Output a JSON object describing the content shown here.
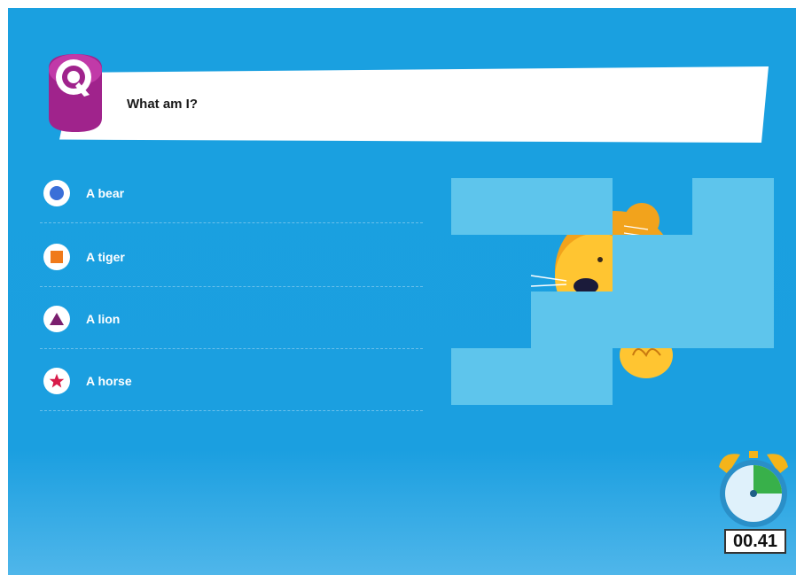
{
  "question": {
    "text": "What am I?",
    "badge_icon": "q-logo-icon"
  },
  "answers": [
    {
      "label": "A bear",
      "shape": "circle-icon",
      "color": "#3a6fd8"
    },
    {
      "label": "A tiger",
      "shape": "square-icon",
      "color": "#f07a1a"
    },
    {
      "label": "A lion",
      "shape": "triangle-icon",
      "color": "#7a1f6e"
    },
    {
      "label": "A horse",
      "shape": "star-icon",
      "color": "#d81c4a"
    }
  ],
  "puzzle": {
    "image_icon": "lion-cartoon-icon",
    "tile_color": "#5ec5ec"
  },
  "timer": {
    "readout": "00.41",
    "icon": "alarm-clock-icon"
  },
  "colors": {
    "background": "#1aa0e0",
    "badge": "#a0238c"
  }
}
